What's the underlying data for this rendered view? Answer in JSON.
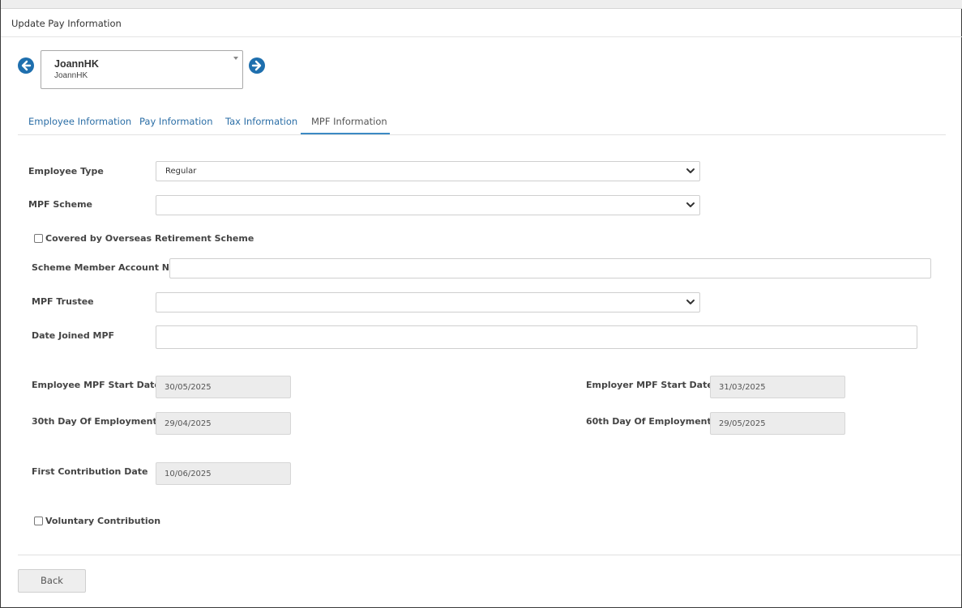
{
  "page": {
    "title": "Update Pay Information"
  },
  "employee_selector": {
    "name": "JoannHK",
    "sub": "JoannHK",
    "prev_icon": "circle-arrow-left-icon",
    "next_icon": "circle-arrow-right-icon"
  },
  "tabs": [
    {
      "label": "Employee Information"
    },
    {
      "label": "Pay Information"
    },
    {
      "label": "Tax Information"
    },
    {
      "label": "MPF Information"
    }
  ],
  "active_tab": "MPF Information",
  "form": {
    "employee_type": {
      "label": "Employee Type",
      "value": "Regular"
    },
    "mpf_scheme": {
      "label": "MPF Scheme",
      "value": ""
    },
    "overseas": {
      "label": "Covered by Overseas Retirement Scheme",
      "checked": false
    },
    "scheme_member_account": {
      "label": "Scheme Member Account No.",
      "value": ""
    },
    "mpf_trustee": {
      "label": "MPF Trustee",
      "value": ""
    },
    "date_joined": {
      "label": "Date Joined MPF",
      "value": ""
    },
    "employee_mpf_start": {
      "label": "Employee MPF Start Date",
      "value": "30/05/2025"
    },
    "employer_mpf_start": {
      "label": "Employer MPF Start Date",
      "value": "31/03/2025"
    },
    "day30": {
      "label": "30th Day Of Employment",
      "value": "29/04/2025"
    },
    "day60": {
      "label": "60th Day Of Employment",
      "value": "29/05/2025"
    },
    "first_contribution": {
      "label": "First Contribution Date",
      "value": "10/06/2025"
    },
    "voluntary": {
      "label": "Voluntary Contribution",
      "checked": false
    }
  },
  "buttons": {
    "back": "Back"
  },
  "colors": {
    "accent": "#1e6fae",
    "tab_link": "#2b6ea6",
    "readonly_bg": "#ececec"
  }
}
